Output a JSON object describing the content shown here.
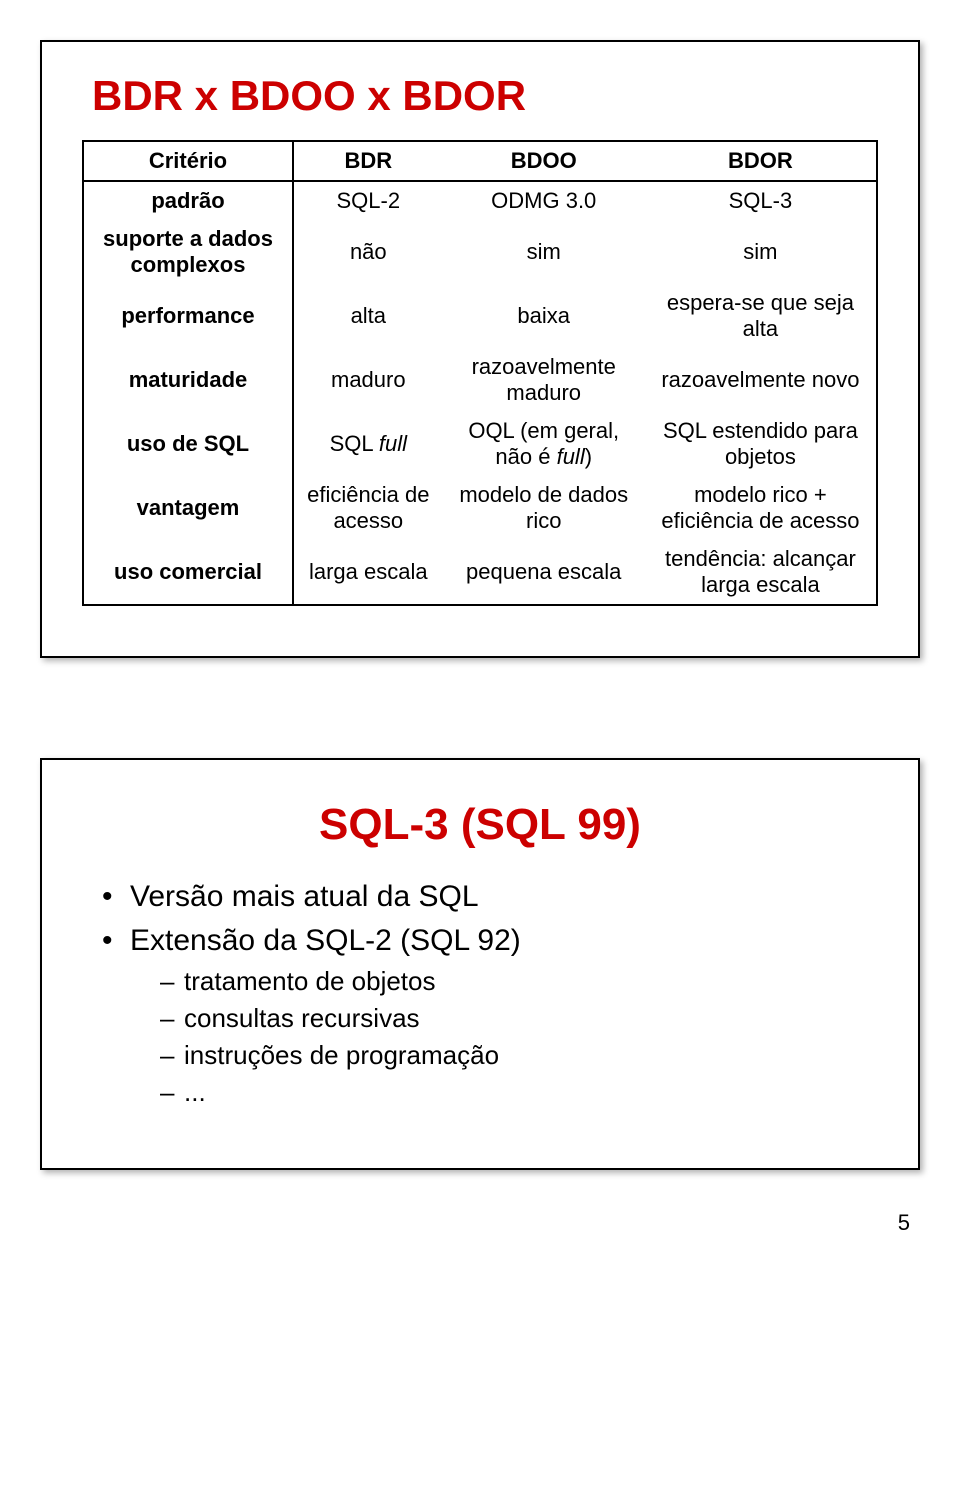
{
  "slide1": {
    "title": "BDR x BDOO x BDOR",
    "headers": [
      "Critério",
      "BDR",
      "BDOO",
      "BDOR"
    ],
    "rows": [
      {
        "c0": "padrão",
        "c1": "SQL-2",
        "c2": "ODMG 3.0",
        "c3": "SQL-3"
      },
      {
        "c0": "suporte a dados complexos",
        "c1": "não",
        "c2": "sim",
        "c3": "sim"
      },
      {
        "c0": "performance",
        "c1": "alta",
        "c2": "baixa",
        "c3": "espera-se que seja alta"
      },
      {
        "c0": "maturidade",
        "c1": "maduro",
        "c2": "razoavelmente maduro",
        "c3": "razoavelmente novo"
      },
      {
        "c0": "uso de SQL",
        "c1_pre": "SQL ",
        "c1_it": "full",
        "c2_pre": "OQL (em geral, não é ",
        "c2_it": "full",
        "c2_post": ")",
        "c3": "SQL estendido para objetos"
      },
      {
        "c0": "vantagem",
        "c1": "eficiência de acesso",
        "c2": "modelo de dados rico",
        "c3": "modelo rico + eficiência de acesso"
      },
      {
        "c0": "uso comercial",
        "c1": "larga escala",
        "c2": "pequena escala",
        "c3": "tendência: alcançar larga escala"
      }
    ]
  },
  "slide2": {
    "title": "SQL-3 (SQL 99)",
    "b1": "Versão mais atual da SQL",
    "b2": "Extensão da SQL-2 (SQL 92)",
    "subs": {
      "s1": "tratamento de objetos",
      "s2": "consultas recursivas",
      "s3": "instruções de programação",
      "s4": "..."
    }
  },
  "pagenum": "5"
}
